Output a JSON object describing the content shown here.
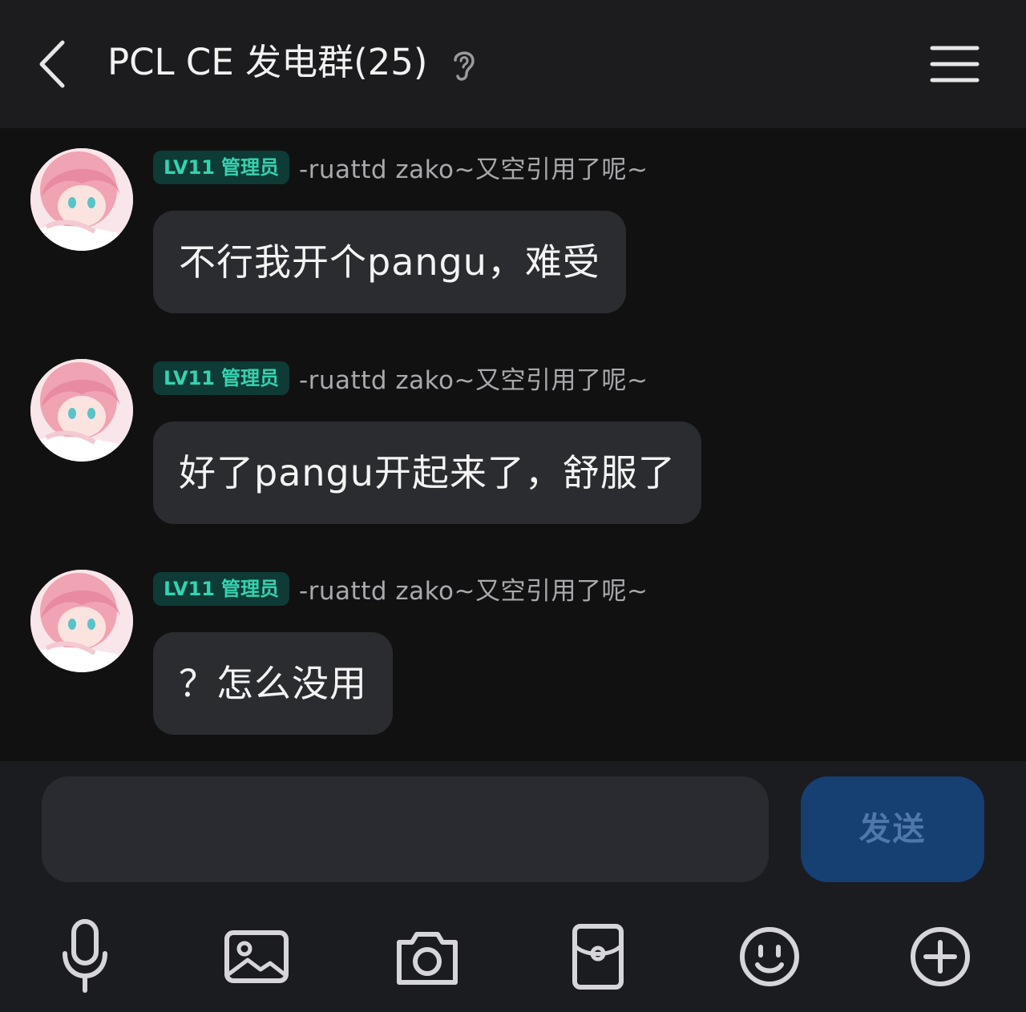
{
  "header": {
    "title": "PCL CE 发电群(25)",
    "back_icon": "chevron-left-icon",
    "ear_icon": "ear-icon",
    "menu_icon": "hamburger-menu-icon"
  },
  "messages": [
    {
      "level": "LV11",
      "role": "管理员",
      "sender": "-ruattd zako~又空引用了呢~",
      "text": "不行我开个pangu，难受"
    },
    {
      "level": "LV11",
      "role": "管理员",
      "sender": "-ruattd zako~又空引用了呢~",
      "text": "好了pangu开起来了，舒服了"
    },
    {
      "level": "LV11",
      "role": "管理员",
      "sender": "-ruattd zako~又空引用了呢~",
      "text": "？怎么没用"
    }
  ],
  "composer": {
    "input_value": "",
    "send_label": "发送"
  },
  "toolbar": {
    "icons": [
      "microphone-icon",
      "image-icon",
      "camera-icon",
      "red-packet-icon",
      "emoji-icon",
      "plus-icon"
    ]
  },
  "colors": {
    "background": "#111111",
    "header": "#1c1c1e",
    "bubble": "#2a2c30",
    "badge_bg": "#0e3b35",
    "badge_text": "#35d3b0",
    "send_bg": "#163f72",
    "send_text": "#4f78a8"
  }
}
